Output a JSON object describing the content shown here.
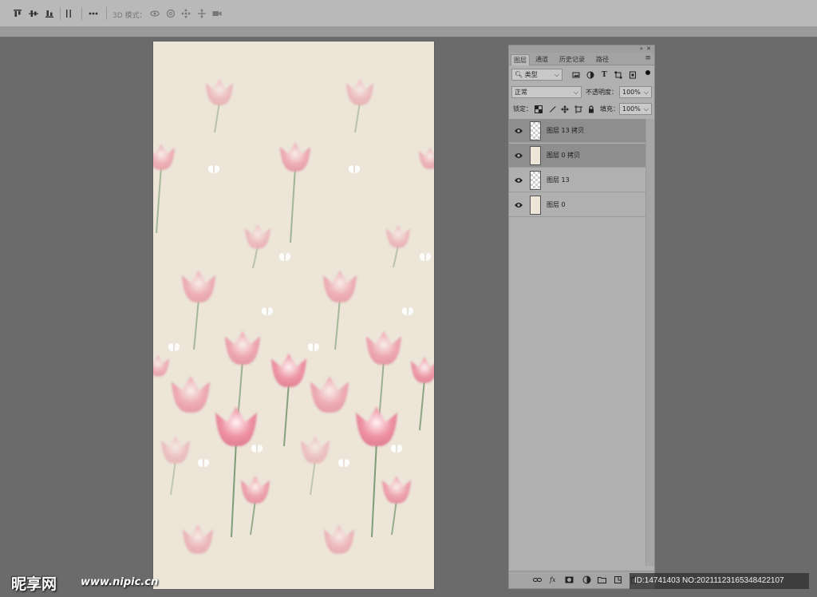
{
  "options_bar": {
    "mode_label": "3D 模式：",
    "tools": [
      "align-top-icon",
      "align-vcenter-icon",
      "align-bottom-icon",
      "distribute-icon",
      "more-icon",
      "orbit-3d-icon",
      "roll-3d-icon",
      "pan-3d-icon",
      "slide-3d-icon",
      "camera-3d-icon"
    ]
  },
  "layers_panel": {
    "tabs": [
      {
        "label": "图层",
        "active": true
      },
      {
        "label": "通道",
        "active": false
      },
      {
        "label": "历史记录",
        "active": false
      },
      {
        "label": "路径",
        "active": false
      }
    ],
    "filter": {
      "label": "类型"
    },
    "blend_mode": "正常",
    "opacity": {
      "label": "不透明度：",
      "value": "100%"
    },
    "lock": {
      "label": "锁定："
    },
    "fill": {
      "label": "填充：",
      "value": "100%"
    },
    "layers": [
      {
        "name": "图层 13 拷贝",
        "selected": true,
        "thumb": "transparent"
      },
      {
        "name": "图层 0 拷贝",
        "selected": true,
        "thumb": "solid"
      },
      {
        "name": "图层 13",
        "selected": false,
        "thumb": "transparent"
      },
      {
        "name": "图层 0",
        "selected": false,
        "thumb": "solid"
      }
    ],
    "bottom_icons": [
      "link-icon",
      "fx-icon",
      "mask-icon",
      "adjustment-icon",
      "folder-icon",
      "new-layer-icon",
      "trash-icon"
    ]
  },
  "watermark": {
    "logo": "昵享网",
    "url": "www.nipic.cn",
    "id_text": "ID:14741403 NO:20211123165348422107"
  },
  "colors": {
    "workspace": "#6b6b6b",
    "canvas_background": "#ece5d8",
    "tulip_pink": "#ef8ea0",
    "stem_green": "#7a9a72"
  }
}
